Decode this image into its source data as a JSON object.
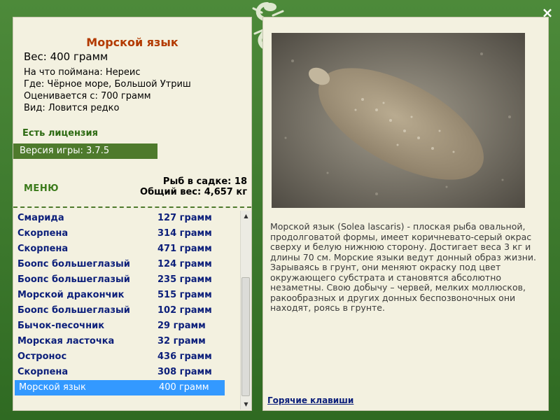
{
  "fish": {
    "title": "Морской язык",
    "weight": "Вес: 400 грамм",
    "caught_on": "На что поймана: Нереис",
    "where": "Где: Чёрное море, Большой Утриш",
    "price": "Оценивается с: 700 грамм",
    "kind": "Вид: Ловится редко",
    "description": "Морской язык (Solea lascaris) - плоская рыба овальной, продолговатой формы, имеет коричневато-серый окрас сверху и белую нижнюю сторону. Достигает веса 3 кг и длины 70 см. Морские языки ведут донный образ жизни. Зарываясь в грунт, они меняют окраску под цвет окружающего субстрата и становятся абсолютно незаметны. Свою добычу – червей, мелких моллюсков, ракообразных и других донных беспозвоночных они находят, роясь в грунте."
  },
  "license": "Есть лицензия",
  "version": "Версия игры: 3.7.5",
  "menu_label": "МЕНЮ",
  "stats": {
    "fish_in_cage": "Рыб в садке: 18",
    "total_weight": "Общий вес: 4,657 кг"
  },
  "catch_list": [
    {
      "name": "Смарида",
      "weight": "127 грамм"
    },
    {
      "name": "Скорпена",
      "weight": "314 грамм"
    },
    {
      "name": "Скорпена",
      "weight": "471 грамм"
    },
    {
      "name": "Боопс большеглазый",
      "weight": "124 грамм"
    },
    {
      "name": "Боопс большеглазый",
      "weight": "235 грамм"
    },
    {
      "name": "Морской дракончик",
      "weight": "515 грамм"
    },
    {
      "name": "Боопс большеглазый",
      "weight": "102 грамм"
    },
    {
      "name": "Бычок-песочник",
      "weight": "29 грамм"
    },
    {
      "name": "Морская ласточка",
      "weight": "32 грамм"
    },
    {
      "name": "Остронос",
      "weight": "436 грамм"
    },
    {
      "name": "Скорпена",
      "weight": "308 грамм"
    },
    {
      "name": "Морской язык",
      "weight": "400 грамм",
      "selected": true
    }
  ],
  "hotkeys_link": "Горячие клавиши",
  "close_icon": "×",
  "colors": {
    "frame_green": "#3f7a2e",
    "panel_bg": "#f3f1e0",
    "title_color": "#b33a00",
    "list_text": "#0c1f7a",
    "selection": "#3399ff"
  }
}
